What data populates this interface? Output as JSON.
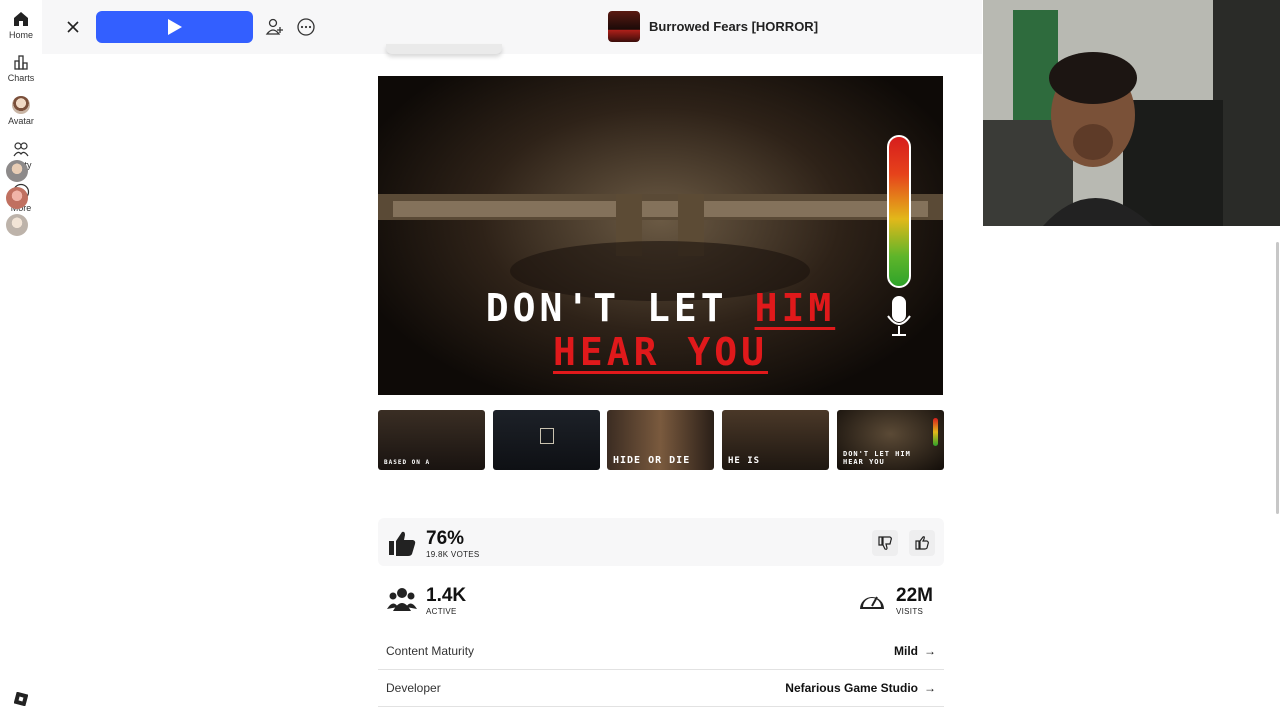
{
  "sidebar": {
    "items": [
      {
        "label": "Home"
      },
      {
        "label": "Charts"
      },
      {
        "label": "Avatar"
      },
      {
        "label": "Party"
      },
      {
        "label": "More"
      }
    ]
  },
  "topbar": {
    "game_title": "Burrowed Fears [HORROR]"
  },
  "hero": {
    "line1_white": "DON'T LET ",
    "line1_red": "HIM",
    "line2": "HEAR YOU"
  },
  "thumbnails": [
    {
      "caption": "BASED ON A"
    },
    {
      "caption": ""
    },
    {
      "caption": "HIDE OR DIE"
    },
    {
      "caption": "HE IS"
    },
    {
      "caption": "DON'T LET HIM HEAR YOU"
    }
  ],
  "stats": {
    "rating": "76%",
    "votes": "19.8K VOTES",
    "active_value": "1.4K",
    "active_label": "ACTIVE",
    "visits_value": "22M",
    "visits_label": "VISITS"
  },
  "info": [
    {
      "label": "Content Maturity",
      "value": "Mild"
    },
    {
      "label": "Developer",
      "value": "Nefarious Game Studio"
    }
  ],
  "icons": {
    "close": "close-icon",
    "play": "play-icon",
    "friends": "add-friend-icon",
    "more": "more-options-icon"
  }
}
